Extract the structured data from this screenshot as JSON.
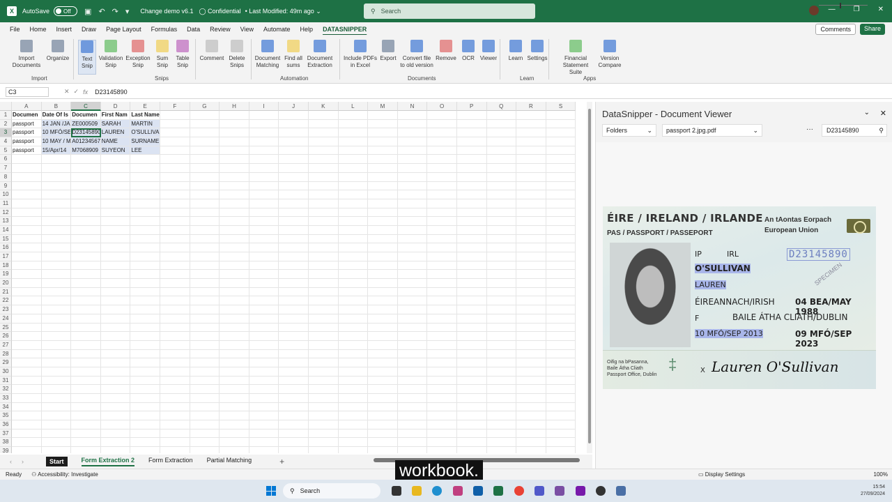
{
  "titlebar": {
    "autosave_label": "AutoSave",
    "autosave_state": "Off",
    "doc_title": "Change demo v6.1",
    "sensitivity": "Confidential",
    "modified": "Last Modified: 49m ago",
    "search_placeholder": "Search",
    "brand_color": "#1e7145"
  },
  "tabs": [
    "File",
    "Home",
    "Insert",
    "Draw",
    "Page Layout",
    "Formulas",
    "Data",
    "Review",
    "View",
    "Automate",
    "Help",
    "DATASNIPPER"
  ],
  "active_tab": "DATASNIPPER",
  "comments_label": "Comments",
  "share_label": "Share",
  "ribbon": {
    "buttons": [
      {
        "label": "Import Documents",
        "l2": "",
        "icon": "import-icon",
        "color": "#7a8aa0"
      },
      {
        "label": "Organize",
        "l2": "",
        "icon": "organize-icon",
        "color": "#7a8aa0"
      },
      {
        "label": "Text",
        "l2": "Snip",
        "icon": "text-snip-icon",
        "color": "#4a7fd6"
      },
      {
        "label": "Validation",
        "l2": "Snip",
        "icon": "validation-snip-icon",
        "color": "#6abf69"
      },
      {
        "label": "Exception",
        "l2": "Snip",
        "icon": "exception-snip-icon",
        "color": "#e07070"
      },
      {
        "label": "Sum",
        "l2": "Snip",
        "icon": "sum-snip-icon",
        "color": "#f0d060"
      },
      {
        "label": "Table",
        "l2": "Snip",
        "icon": "table-snip-icon",
        "color": "#c070c0"
      },
      {
        "label": "Comment",
        "l2": "",
        "icon": "comment-icon",
        "color": "#c0c0c0"
      },
      {
        "label": "Delete",
        "l2": "Snips",
        "icon": "delete-snips-icon",
        "color": "#c0c0c0"
      },
      {
        "label": "Document",
        "l2": "Matching",
        "icon": "document-matching-icon",
        "color": "#4a7fd6"
      },
      {
        "label": "Find all",
        "l2": "sums",
        "icon": "find-sums-icon",
        "color": "#f0d060"
      },
      {
        "label": "Document",
        "l2": "Extraction",
        "icon": "document-extraction-icon",
        "color": "#4a7fd6"
      },
      {
        "label": "Include PDFs",
        "l2": "in Excel",
        "icon": "include-pdfs-icon",
        "color": "#4a7fd6"
      },
      {
        "label": "Export",
        "l2": "",
        "icon": "export-icon",
        "color": "#7a8aa0"
      },
      {
        "label": "Convert file",
        "l2": "to old version",
        "icon": "convert-icon",
        "color": "#4a7fd6"
      },
      {
        "label": "Remove",
        "l2": "",
        "icon": "remove-icon",
        "color": "#e07070"
      },
      {
        "label": "OCR",
        "l2": "",
        "icon": "ocr-icon",
        "color": "#4a7fd6"
      },
      {
        "label": "Viewer",
        "l2": "",
        "icon": "viewer-icon",
        "color": "#4a7fd6"
      },
      {
        "label": "Learn",
        "l2": "",
        "icon": "learn-icon",
        "color": "#4a7fd6"
      },
      {
        "label": "Settings",
        "l2": "",
        "icon": "settings-icon",
        "color": "#4a7fd6"
      },
      {
        "label": "Financial",
        "l2": "Statement Suite",
        "icon": "financial-icon",
        "color": "#6abf69"
      },
      {
        "label": "Version",
        "l2": "Compare",
        "icon": "version-compare-icon",
        "color": "#4a7fd6"
      }
    ],
    "groups": [
      "Import",
      "Snips",
      "Automation",
      "Documents",
      "Learn",
      "Apps"
    ]
  },
  "formula": {
    "cell_ref": "C3",
    "content": "D23145890"
  },
  "columns": [
    "A",
    "B",
    "C",
    "D",
    "E",
    "F",
    "G",
    "H",
    "I",
    "J",
    "K",
    "L",
    "M",
    "N",
    "O",
    "P",
    "Q",
    "R",
    "S"
  ],
  "rows": [
    [
      "Documen",
      "Date Of Is",
      "Documen",
      "First Nam",
      "Last Name"
    ],
    [
      "passport",
      "14 JAN /JA",
      "ZE000509",
      "SARAH",
      "MARTIN"
    ],
    [
      "passport",
      "10 MFÓ/SE",
      "D23145890",
      "LAUREN",
      "O'SULLIVAN"
    ],
    [
      "passport",
      "10 MAY / M",
      "A01234567",
      "NAME",
      "SURNAME"
    ],
    [
      "passport",
      "15/Apr/14",
      "M7068909",
      "SUYEON",
      "LEE"
    ]
  ],
  "row_count": 39,
  "sheets": [
    "Start",
    "Form Extraction 2",
    "Form Extraction",
    "Partial Matching"
  ],
  "active_sheet": "Form Extraction 2",
  "status": {
    "ready": "Ready",
    "accessibility": "Accessibility: Investigate",
    "display_settings": "Display Settings",
    "zoom": "100%"
  },
  "panel": {
    "title": "DataSnipper - Document Viewer",
    "folders": "Folders",
    "file": "passport 2.jpg.pdf",
    "search_value": "D23145890"
  },
  "passport": {
    "title1": "ÉIRE / IRELAND / IRLANDE",
    "title2": "PAS / PASSPORT / PASSEPORT",
    "eu1": "An tAontas Eorpach",
    "eu2": "European Union",
    "type": "IP",
    "country": "IRL",
    "number": "D23145890",
    "surname": "O'SULLIVAN",
    "given": "LAUREN",
    "nationality": "ÉIREANNACH/IRISH",
    "dob": "04 BEA/MAY 1988",
    "sex": "F",
    "pob": "BAILE ÁTHA CLIATH/DUBLIN",
    "issue": "10 MFÓ/SEP 2013",
    "expiry": "09 MFÓ/SEP 2023",
    "specimen": "SPECIMEN",
    "office1": "Oifig na bPasanna,",
    "office2": "Baile Átha Cliath",
    "office3": "Passport Office, Dublin",
    "signature": "Lauren O'Sullivan",
    "x_mark": "X"
  },
  "subtitle": "workbook.",
  "taskbar": {
    "search": "Search",
    "time": "15:54",
    "date": "27/09/2024"
  }
}
